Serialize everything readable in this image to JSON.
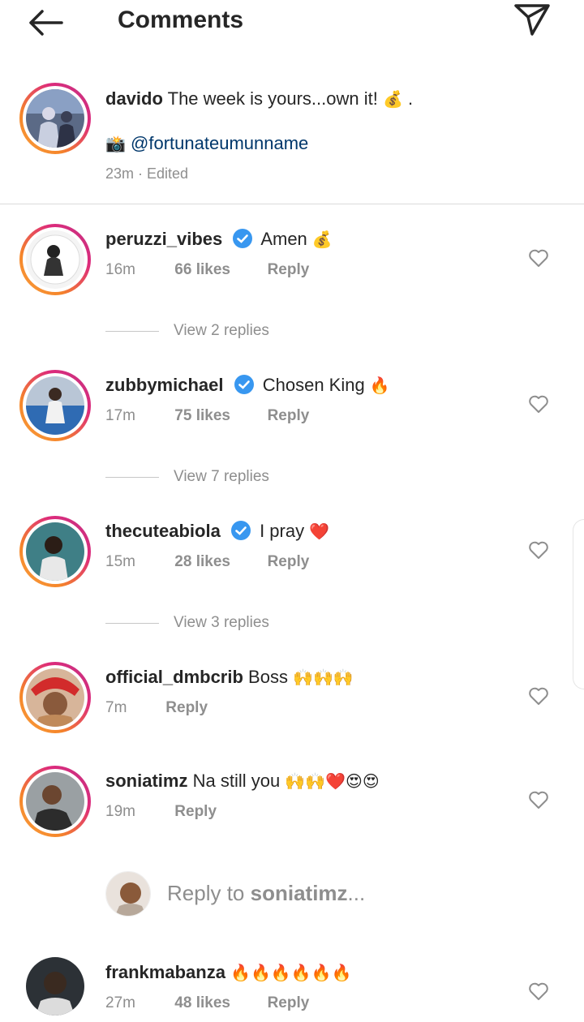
{
  "header": {
    "title": "Comments",
    "back_icon": "arrow-left-icon",
    "send_icon": "paper-plane-icon"
  },
  "caption": {
    "username": "davido",
    "text": "The week is yours...own it!",
    "emoji": "💰",
    "suffix": ".",
    "camera_emoji": "📸",
    "mention": "@fortunateumunname",
    "meta": "23m · Edited"
  },
  "comments": [
    {
      "username": "peruzzi_vibes",
      "verified": true,
      "text": "Amen",
      "emoji": "💰",
      "time": "16m",
      "likes": "66 likes",
      "reply": "Reply",
      "view_replies": "View 2 replies"
    },
    {
      "username": "zubbymichael",
      "verified": true,
      "text": "Chosen King",
      "emoji": "🔥",
      "time": "17m",
      "likes": "75 likes",
      "reply": "Reply",
      "view_replies": "View 7 replies"
    },
    {
      "username": "thecuteabiola",
      "verified": true,
      "text": "I pray",
      "emoji": "❤️",
      "time": "15m",
      "likes": "28 likes",
      "reply": "Reply",
      "view_replies": "View 3 replies"
    },
    {
      "username": "official_dmbcrib",
      "verified": false,
      "text": "Boss",
      "emoji": "🙌🙌🙌",
      "time": "7m",
      "likes": "",
      "reply": "Reply"
    },
    {
      "username": "soniatimz",
      "verified": false,
      "text": "Na still you",
      "emoji": "🙌🙌❤️😍😍",
      "time": "19m",
      "likes": "",
      "reply": "Reply"
    },
    {
      "username": "frankmabanza",
      "verified": false,
      "text": "",
      "emoji": "🔥🔥🔥🔥🔥🔥",
      "time": "27m",
      "likes": "48 likes",
      "reply": "Reply"
    }
  ],
  "reply_box": {
    "prefix": "Reply to",
    "username": "soniatimz",
    "suffix": "..."
  },
  "colors": {
    "text": "#262626",
    "muted": "#8e8e8e",
    "link": "#00376b",
    "verified": "#3897f0",
    "divider": "#dbdbdb"
  }
}
